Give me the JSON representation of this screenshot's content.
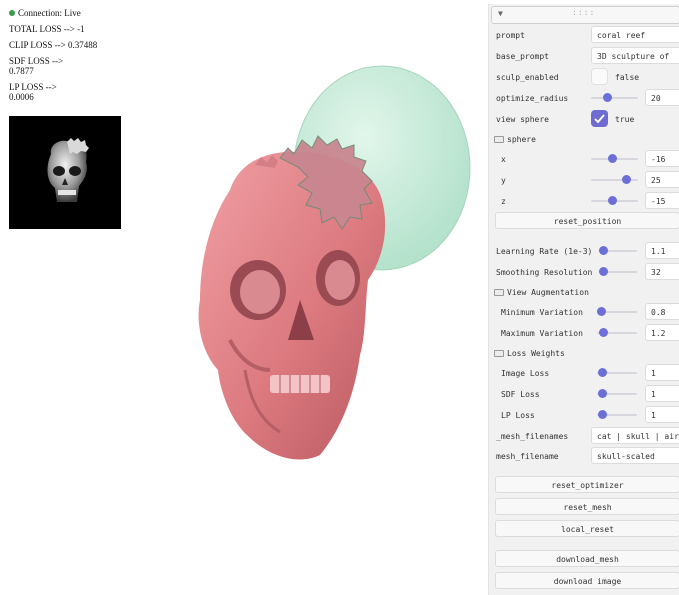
{
  "status": {
    "connection": "Connection: Live",
    "total_loss": "TOTAL LOSS --> -1",
    "clip_loss": "CLIP LOSS --> 0.37488",
    "sdf_loss_label": "SDF LOSS -->",
    "sdf_loss_value": "0.7877",
    "lp_loss_label": "LP LOSS -->",
    "lp_loss_value": "0.0006",
    "live_color": "#3a9d4a"
  },
  "panel": {
    "collapse_icon": "caret-down-icon",
    "grip_icon": "drag-handle-icon",
    "prompt_label": "prompt",
    "prompt_value": "coral reef",
    "base_prompt_label": "base_prompt",
    "base_prompt_value": "3D sculpture of",
    "sculp_enabled_label": "sculp_enabled",
    "sculp_enabled_value": "false",
    "optimize_radius_label": "optimize_radius",
    "optimize_radius_value": "20",
    "view_sphere_label": "view sphere",
    "view_sphere_value": "true",
    "sphere_folder": "sphere",
    "x_label": "x",
    "x_value": "-16",
    "y_label": "y",
    "y_value": "25",
    "z_label": "z",
    "z_value": "-15",
    "reset_position": "reset_position",
    "learning_rate_label": "Learning Rate (1e-3)",
    "learning_rate_value": "1.1",
    "smoothing_label": "Smoothing Resolution",
    "smoothing_value": "32",
    "view_aug_folder": "View Augmentation",
    "min_var_label": "Minimum Variation",
    "min_var_value": "0.8",
    "max_var_label": "Maximum Variation",
    "max_var_value": "1.2",
    "loss_weights_folder": "Loss Weights",
    "image_loss_label": "Image Loss",
    "image_loss_value": "1",
    "sdf_loss_label": "SDF Loss",
    "sdf_loss_value": "1",
    "lp_loss_label": "LP Loss",
    "lp_loss_value": "1",
    "mesh_filenames_label": "_mesh_filenames",
    "mesh_filenames_value": "cat | skull | airplane",
    "mesh_filename_label": "mesh_filename",
    "mesh_filename_value": "skull-scaled",
    "reset_optimizer": "reset_optimizer",
    "reset_mesh": "reset_mesh",
    "local_reset": "local_reset",
    "download_mesh": "download_mesh",
    "download_image": "download image",
    "accent_color": "#6c6fd8"
  },
  "viewport": {
    "skull_color": "#e07e84",
    "sphere_color": "#bfe8d2"
  }
}
